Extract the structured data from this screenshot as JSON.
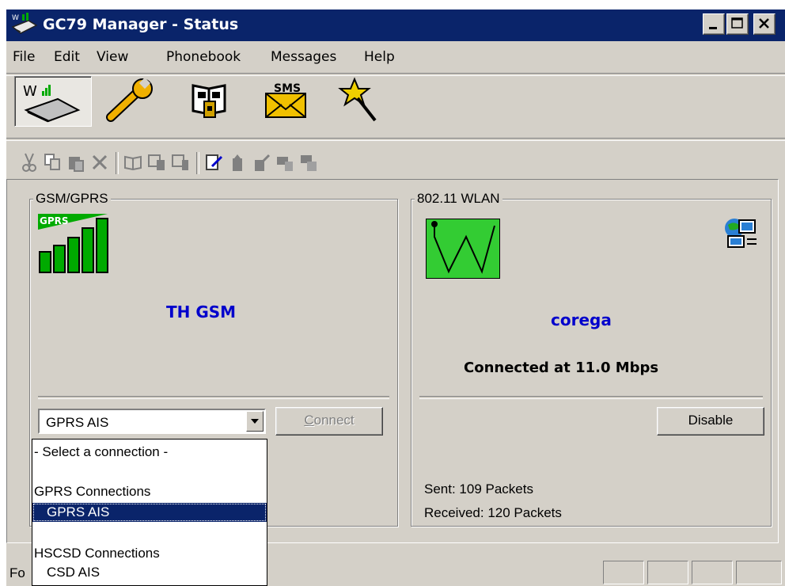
{
  "window": {
    "title": "GC79 Manager - Status"
  },
  "titlebar_buttons": [
    "minimize",
    "maximize",
    "close"
  ],
  "menu": [
    "File",
    "Edit",
    "View",
    "Phonebook",
    "Messages",
    "Help"
  ],
  "big_toolbar": [
    {
      "name": "status",
      "icon": "wireless-card-icon",
      "active": true
    },
    {
      "name": "settings",
      "icon": "wrench-icon"
    },
    {
      "name": "phonebook",
      "icon": "phonebook-icon"
    },
    {
      "name": "sms",
      "icon": "sms-envelope-icon",
      "label": "SMS"
    },
    {
      "name": "wizard",
      "icon": "magic-wand-icon"
    }
  ],
  "small_toolbar": [
    "cut-icon",
    "copy-icon",
    "paste-icon",
    "delete-icon",
    "phonebook-small-icon",
    "copy-to-sim-icon",
    "copy-to-phone-icon",
    "edit-icon",
    "sim-icon",
    "sim-upload-icon",
    "sim-to-phone-icon",
    "phone-to-sim-icon"
  ],
  "gsm": {
    "label": "GSM/GPRS",
    "signal_badge": "GPRS",
    "network": "TH GSM",
    "selected_connection": "GPRS AIS",
    "connect_label": "Connect",
    "connect_mnemonic_rest": "onnect",
    "connect_mnemonic": "C"
  },
  "wlan": {
    "label": "802.11 WLAN",
    "ssid": "corega",
    "status": "Connected at 11.0 Mbps",
    "disable_label": "Disable",
    "sent": "Sent: 109 Packets",
    "received": "Received: 120 Packets"
  },
  "dropdown": {
    "items": [
      {
        "text": "- Select a connection -",
        "indent": false,
        "selected": false
      },
      {
        "text": "",
        "indent": false,
        "selected": false
      },
      {
        "text": "GPRS Connections",
        "indent": false,
        "selected": false
      },
      {
        "text": "GPRS AIS",
        "indent": true,
        "selected": true
      },
      {
        "text": "",
        "indent": false,
        "selected": false
      },
      {
        "text": "HSCSD Connections",
        "indent": false,
        "selected": false
      },
      {
        "text": "CSD AIS",
        "indent": true,
        "selected": false
      }
    ]
  },
  "statusbar": {
    "text_prefix": "Fo"
  },
  "colors": {
    "titlebar": "#0a246a",
    "face": "#d4d0c8",
    "network_name": "#0000cc",
    "signal_green": "#00aa00"
  }
}
